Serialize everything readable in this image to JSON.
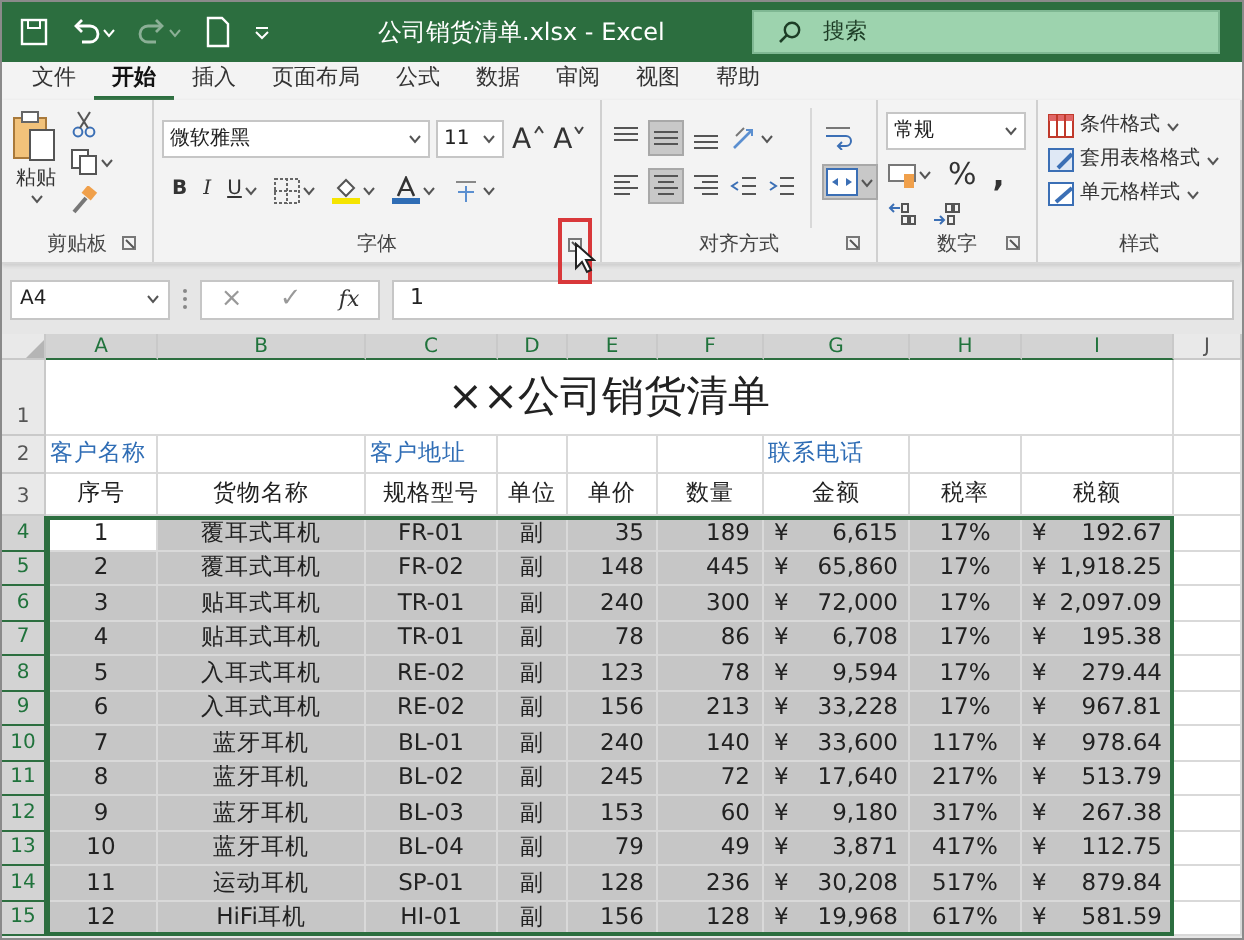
{
  "window": {
    "title": "公司销货清单.xlsx  -  Excel",
    "search_placeholder": "搜索"
  },
  "quick_access": [
    {
      "kind": "save",
      "disabled": false
    },
    {
      "kind": "undo",
      "disabled": false
    },
    {
      "kind": "redo",
      "disabled": true
    },
    {
      "kind": "new",
      "disabled": false
    }
  ],
  "menu_tabs": [
    {
      "label": "文件",
      "selected": false
    },
    {
      "label": "开始",
      "selected": true
    },
    {
      "label": "插入",
      "selected": false
    },
    {
      "label": "页面布局",
      "selected": false
    },
    {
      "label": "公式",
      "selected": false
    },
    {
      "label": "数据",
      "selected": false
    },
    {
      "label": "审阅",
      "selected": false
    },
    {
      "label": "视图",
      "selected": false
    },
    {
      "label": "帮助",
      "selected": false
    }
  ],
  "ribbon": {
    "clipboard": {
      "paste_label": "粘贴",
      "group_label": "剪贴板"
    },
    "font": {
      "font_name": "微软雅黑",
      "font_size": "11",
      "grow_label": "A",
      "shrink_label": "A",
      "bold": "B",
      "italic": "I",
      "underline": "U",
      "group_label": "字体",
      "launcher_highlighted": true
    },
    "alignment": {
      "vertical": [
        {
          "kind": "top",
          "selected": false
        },
        {
          "kind": "middle",
          "selected": true
        },
        {
          "kind": "bottom",
          "selected": false
        }
      ],
      "horizontal": [
        {
          "kind": "left",
          "selected": false
        },
        {
          "kind": "center",
          "selected": true
        },
        {
          "kind": "right",
          "selected": false
        }
      ],
      "merge_selected": true,
      "group_label": "对齐方式"
    },
    "number": {
      "format": "常规",
      "percent": "%",
      "comma": ",",
      "group_label": "数字"
    },
    "styles": {
      "items": [
        "条件格式",
        "套用表格格式",
        "单元格样式"
      ],
      "group_label": "样式"
    }
  },
  "formula_bar": {
    "name_box": "A4",
    "cancel": "×",
    "enter": "✓",
    "function": "fx",
    "value": "1"
  },
  "sheet": {
    "columns": [
      {
        "label": "A",
        "selected": true
      },
      {
        "label": "B",
        "selected": true
      },
      {
        "label": "C",
        "selected": true
      },
      {
        "label": "D",
        "selected": true
      },
      {
        "label": "E",
        "selected": true
      },
      {
        "label": "F",
        "selected": true
      },
      {
        "label": "G",
        "selected": true
      },
      {
        "label": "H",
        "selected": true
      },
      {
        "label": "I",
        "selected": true
      },
      {
        "label": "J",
        "selected": false
      }
    ],
    "title_row": {
      "number": "1",
      "title": "××公司销货清单"
    },
    "info_row": {
      "number": "2",
      "labels": [
        "客户名称",
        "客户地址",
        "联系电话"
      ]
    },
    "header_row": {
      "number": "3",
      "cells": [
        "序号",
        "货物名称",
        "规格型号",
        "单位",
        "单价",
        "数量",
        "金额",
        "税率",
        "税额"
      ]
    },
    "rows": [
      {
        "number": "4",
        "selected": true,
        "active": true,
        "cells": [
          "1",
          "覆耳式耳机",
          "FR-01",
          "副",
          "35",
          "189",
          {
            "currency": "¥",
            "amount": "6,615"
          },
          "17%",
          {
            "currency": "¥",
            "amount": "192.67"
          }
        ]
      },
      {
        "number": "5",
        "selected": true,
        "active": false,
        "cells": [
          "2",
          "覆耳式耳机",
          "FR-02",
          "副",
          "148",
          "445",
          {
            "currency": "¥",
            "amount": "65,860"
          },
          "17%",
          {
            "currency": "¥",
            "amount": "1,918.25"
          }
        ]
      },
      {
        "number": "6",
        "selected": true,
        "active": false,
        "cells": [
          "3",
          "贴耳式耳机",
          "TR-01",
          "副",
          "240",
          "300",
          {
            "currency": "¥",
            "amount": "72,000"
          },
          "17%",
          {
            "currency": "¥",
            "amount": "2,097.09"
          }
        ]
      },
      {
        "number": "7",
        "selected": true,
        "active": false,
        "cells": [
          "4",
          "贴耳式耳机",
          "TR-01",
          "副",
          "78",
          "86",
          {
            "currency": "¥",
            "amount": "6,708"
          },
          "17%",
          {
            "currency": "¥",
            "amount": "195.38"
          }
        ]
      },
      {
        "number": "8",
        "selected": true,
        "active": false,
        "cells": [
          "5",
          "入耳式耳机",
          "RE-02",
          "副",
          "123",
          "78",
          {
            "currency": "¥",
            "amount": "9,594"
          },
          "17%",
          {
            "currency": "¥",
            "amount": "279.44"
          }
        ]
      },
      {
        "number": "9",
        "selected": true,
        "active": false,
        "cells": [
          "6",
          "入耳式耳机",
          "RE-02",
          "副",
          "156",
          "213",
          {
            "currency": "¥",
            "amount": "33,228"
          },
          "17%",
          {
            "currency": "¥",
            "amount": "967.81"
          }
        ]
      },
      {
        "number": "10",
        "selected": true,
        "active": false,
        "cells": [
          "7",
          "蓝牙耳机",
          "BL-01",
          "副",
          "240",
          "140",
          {
            "currency": "¥",
            "amount": "33,600"
          },
          "117%",
          {
            "currency": "¥",
            "amount": "978.64"
          }
        ]
      },
      {
        "number": "11",
        "selected": true,
        "active": false,
        "cells": [
          "8",
          "蓝牙耳机",
          "BL-02",
          "副",
          "245",
          "72",
          {
            "currency": "¥",
            "amount": "17,640"
          },
          "217%",
          {
            "currency": "¥",
            "amount": "513.79"
          }
        ]
      },
      {
        "number": "12",
        "selected": true,
        "active": false,
        "cells": [
          "9",
          "蓝牙耳机",
          "BL-03",
          "副",
          "153",
          "60",
          {
            "currency": "¥",
            "amount": "9,180"
          },
          "317%",
          {
            "currency": "¥",
            "amount": "267.38"
          }
        ]
      },
      {
        "number": "13",
        "selected": true,
        "active": false,
        "cells": [
          "10",
          "蓝牙耳机",
          "BL-04",
          "副",
          "79",
          "49",
          {
            "currency": "¥",
            "amount": "3,871"
          },
          "417%",
          {
            "currency": "¥",
            "amount": "112.75"
          }
        ]
      },
      {
        "number": "14",
        "selected": true,
        "active": false,
        "cells": [
          "11",
          "运动耳机",
          "SP-01",
          "副",
          "128",
          "236",
          {
            "currency": "¥",
            "amount": "30,208"
          },
          "517%",
          {
            "currency": "¥",
            "amount": "879.84"
          }
        ]
      },
      {
        "number": "15",
        "selected": true,
        "active": false,
        "cells": [
          "12",
          "HiFi耳机",
          "HI-01",
          "副",
          "156",
          "128",
          {
            "currency": "¥",
            "amount": "19,968"
          },
          "617%",
          {
            "currency": "¥",
            "amount": "581.59"
          }
        ]
      }
    ]
  }
}
